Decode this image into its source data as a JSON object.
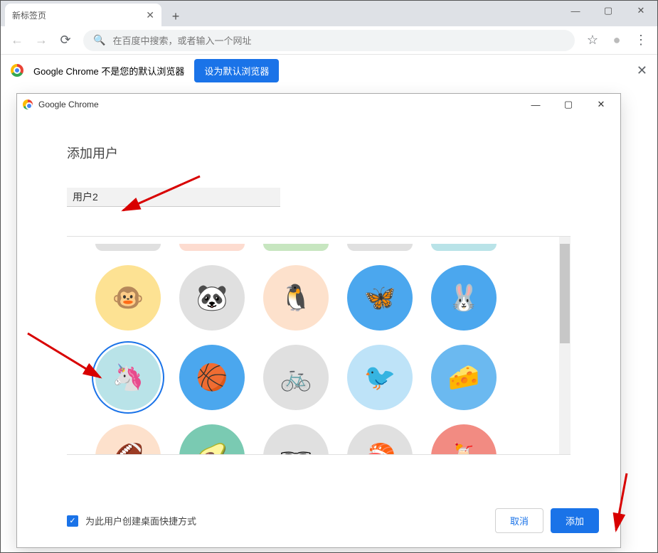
{
  "window": {
    "tab_title": "新标签页"
  },
  "toolbar": {
    "omnibox_placeholder": "在百度中搜索，或者输入一个网址"
  },
  "infobar": {
    "message": "Google Chrome 不是您的默认浏览器",
    "button_label": "设为默认浏览器"
  },
  "dialog": {
    "window_title": "Google Chrome",
    "heading": "添加用户",
    "username_value": "用户2",
    "checkbox_label": "为此用户创建桌面快捷方式",
    "cancel_label": "取消",
    "add_label": "添加",
    "avatars": [
      {
        "name": "monkey",
        "bg": "#fde293",
        "emoji": "🐵"
      },
      {
        "name": "panda",
        "bg": "#e0e0e0",
        "emoji": "🐼"
      },
      {
        "name": "penguin",
        "bg": "#fde1cc",
        "emoji": "🐧"
      },
      {
        "name": "butterfly",
        "bg": "#4ba7ee",
        "emoji": "🦋"
      },
      {
        "name": "rabbit",
        "bg": "#4ba7ee",
        "emoji": "🐰"
      },
      {
        "name": "unicorn",
        "bg": "#b9e3e8",
        "emoji": "🦄",
        "selected": true
      },
      {
        "name": "basketball",
        "bg": "#4ba7ee",
        "emoji": "🏀"
      },
      {
        "name": "bicycle",
        "bg": "#e0e0e0",
        "emoji": "🚲"
      },
      {
        "name": "bird",
        "bg": "#bee3f8",
        "emoji": "🐦"
      },
      {
        "name": "cheese",
        "bg": "#6bb9f0",
        "emoji": "🧀"
      },
      {
        "name": "football",
        "bg": "#fde1cc",
        "emoji": "🏈"
      },
      {
        "name": "tamarind",
        "bg": "#7acab2",
        "emoji": "🥑"
      },
      {
        "name": "sunglasses",
        "bg": "#e0e0e0",
        "emoji": "🕶"
      },
      {
        "name": "sushi",
        "bg": "#e0e0e0",
        "emoji": "🍣"
      },
      {
        "name": "drink",
        "bg": "#f28b82",
        "emoji": "🍹"
      }
    ]
  }
}
